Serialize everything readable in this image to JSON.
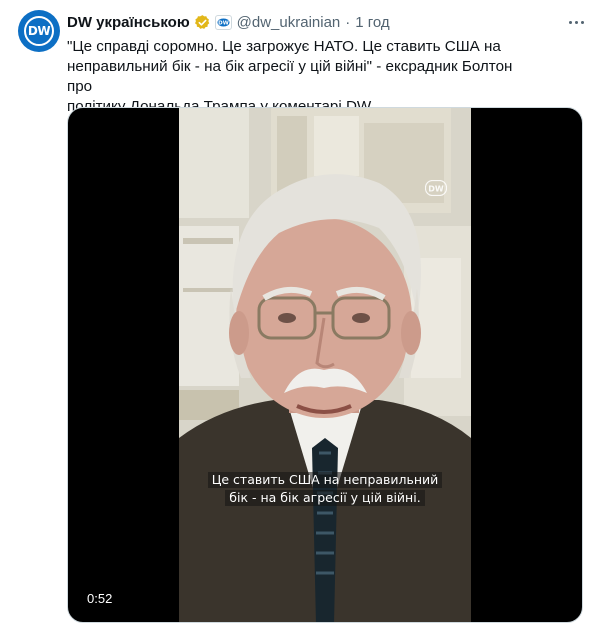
{
  "tweet": {
    "avatar_label": "DW",
    "display_name": "DW українською",
    "handle": "@dw_ukrainian",
    "separator": "·",
    "time": "1 год",
    "text_line1": "\"Це справді соромно. Це загрожує НАТО. Це ставить США на",
    "text_line2": "неправильний бік - на бік агресії у цій війні\" - ексрадник Болтон про",
    "text_line3": "політику Дональда Трампа у коментарі DW."
  },
  "media": {
    "subtitle_line1": "Це ставить США на неправильний",
    "subtitle_line2": "бік - на бік агресії у цій війні.",
    "duration": "0:52",
    "watermark": "DW"
  },
  "icons": {
    "verified": "verified-badge-icon",
    "affiliation": "dw-affiliation-icon",
    "more": "more-options-icon"
  },
  "colors": {
    "brand_blue": "#0d6fc4",
    "verified_gold": "#e2b719",
    "secondary_text": "#536471"
  }
}
